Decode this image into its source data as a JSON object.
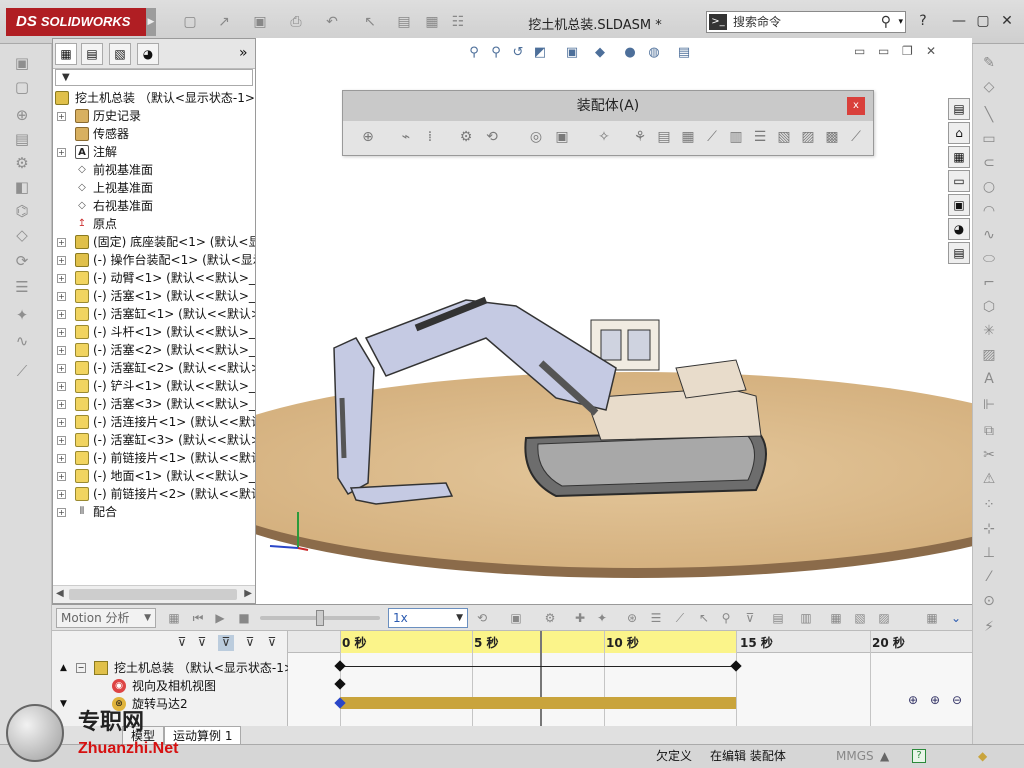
{
  "app": {
    "brand": "SOLIDWORKS",
    "brand_prefix": "DS",
    "document_title": "挖土机总装.SLDASM *",
    "search_placeholder": "搜索命令",
    "colors": {
      "brand_red": "#b01e23",
      "timeline_yellow": "#fbf48a",
      "motor_bar": "#c9a43c"
    }
  },
  "tree": {
    "filter_symbol": "▼",
    "root_label": "挖土机总装 （默认<显示状态-1>)",
    "items": [
      {
        "label": "历史记录",
        "icon": "history-icon"
      },
      {
        "label": "传感器",
        "icon": "sensor-icon"
      },
      {
        "label": "注解",
        "icon": "annotation-icon"
      },
      {
        "label": "前视基准面",
        "icon": "plane-icon"
      },
      {
        "label": "上视基准面",
        "icon": "plane-icon"
      },
      {
        "label": "右视基准面",
        "icon": "plane-icon"
      },
      {
        "label": "原点",
        "icon": "origin-icon"
      },
      {
        "label": "(固定) 底座装配<1> (默认<显",
        "icon": "assembly-icon"
      },
      {
        "label": "(-) 操作台装配<1> (默认<显示",
        "icon": "assembly-icon"
      },
      {
        "label": "(-) 动臂<1> (默认<<默认>_显",
        "icon": "part-icon"
      },
      {
        "label": "(-) 活塞<1> (默认<<默认>_显",
        "icon": "part-icon"
      },
      {
        "label": "(-) 活塞缸<1> (默认<<默认>_",
        "icon": "part-icon"
      },
      {
        "label": "(-) 斗杆<1> (默认<<默认>_显",
        "icon": "part-icon"
      },
      {
        "label": "(-) 活塞<2> (默认<<默认>_显",
        "icon": "part-icon"
      },
      {
        "label": "(-) 活塞缸<2> (默认<<默认>_",
        "icon": "part-icon"
      },
      {
        "label": "(-) 铲斗<1> (默认<<默认>_显",
        "icon": "part-icon"
      },
      {
        "label": "(-) 活塞<3> (默认<<默认>_显",
        "icon": "part-icon"
      },
      {
        "label": "(-) 活连接片<1> (默认<<默认",
        "icon": "part-icon"
      },
      {
        "label": "(-) 活塞缸<3> (默认<<默认>_",
        "icon": "part-icon"
      },
      {
        "label": "(-) 前链接片<1> (默认<<默认",
        "icon": "part-icon"
      },
      {
        "label": "(-) 地面<1> (默认<<默认>_显",
        "icon": "part-icon"
      },
      {
        "label": "(-) 前链接片<2> (默认<<默认",
        "icon": "part-icon"
      },
      {
        "label": "配合",
        "icon": "mate-icon"
      }
    ]
  },
  "floating_toolbar": {
    "title": "装配体(A)",
    "close": "x"
  },
  "motion": {
    "study_type": "Motion 分析",
    "speed": "1x",
    "tree": {
      "root": "挖土机总装 （默认<显示状态-1>",
      "rows": [
        "视向及相机视图",
        "旋转马达2"
      ]
    },
    "ticks": [
      "0 秒",
      "5 秒",
      "10 秒",
      "15 秒",
      "20 秒"
    ]
  },
  "tabs": [
    "模型",
    "运动算例 1"
  ],
  "status": {
    "state": "欠定义",
    "mode": "在编辑 装配体",
    "units": "MMGS",
    "help": "?"
  },
  "watermark": {
    "title": "专职网",
    "url": "Zhuanzhi.Net"
  }
}
